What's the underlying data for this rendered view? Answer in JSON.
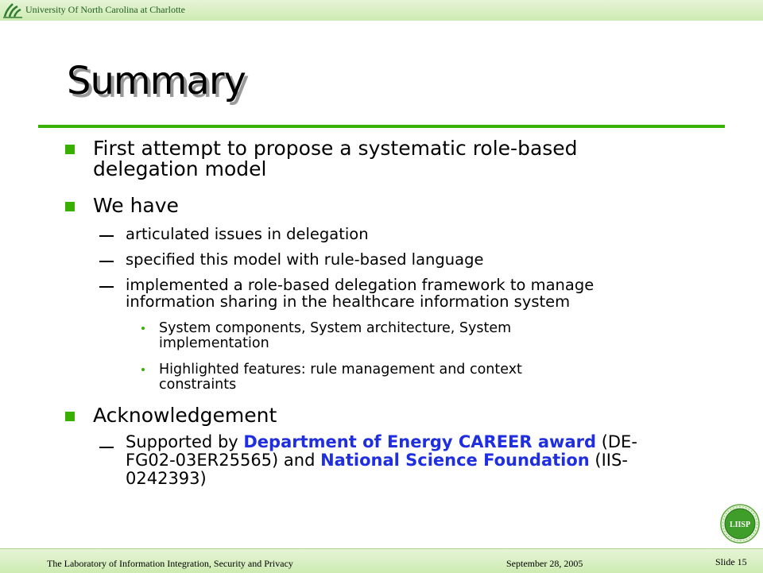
{
  "header": {
    "institution": "University Of North Carolina at Charlotte",
    "logo_icon": "uncc-pinwheel-icon"
  },
  "slide": {
    "title": "Summary",
    "bullets": {
      "b1_line1": "First attempt to propose a systematic role-based",
      "b1_line2": "delegation model",
      "b2": "We have",
      "b2_s1": "articulated issues in delegation",
      "b2_s2": "specified this model with rule-based language",
      "b2_s3_line1": "implemented a role-based delegation framework to manage",
      "b2_s3_line2": "information sharing in the healthcare information system",
      "b2_s3_a_line1": "System components, System architecture, System",
      "b2_s3_a_line2": "implementation",
      "b2_s3_b_line1": "Highlighted  features: rule management and context",
      "b2_s3_b_line2": "constraints",
      "b3": "Acknowledgement",
      "b3_s1_pre": "Supported by ",
      "b3_s1_hl1": "Department of Energy CAREER award",
      "b3_s1_mid1": " (DE-",
      "b3_s1_line2_a": "FG02-03ER25565) and ",
      "b3_s1_hl2": "National Science Foundation",
      "b3_s1_line2_b": " (IIS-",
      "b3_s1_line3": "0242393)"
    },
    "colors": {
      "accent_green": "#38b000",
      "highlight_blue": "#1f2ee0"
    }
  },
  "footer": {
    "lab": "The Laboratory of Information Integration, Security and Privacy",
    "date": "September 28, 2005",
    "slide_label": "Slide",
    "slide_number": "15",
    "badge_text": "LIISP"
  }
}
